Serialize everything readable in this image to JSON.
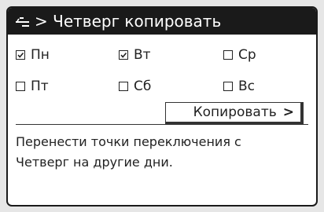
{
  "header": {
    "title": "> Четверг копировать",
    "icon": "menu-return-icon"
  },
  "days": [
    {
      "label": "Пн",
      "checked": true
    },
    {
      "label": "Вт",
      "checked": true
    },
    {
      "label": "Ср",
      "checked": false
    },
    {
      "label": "Пт",
      "checked": false
    },
    {
      "label": "Сб",
      "checked": false
    },
    {
      "label": "Вс",
      "checked": false
    }
  ],
  "copy_button": {
    "label": "Копировать",
    "chevron": ">"
  },
  "description": {
    "line1": "Перенести точки переключения с",
    "line2": "Четверг на другие дни."
  }
}
